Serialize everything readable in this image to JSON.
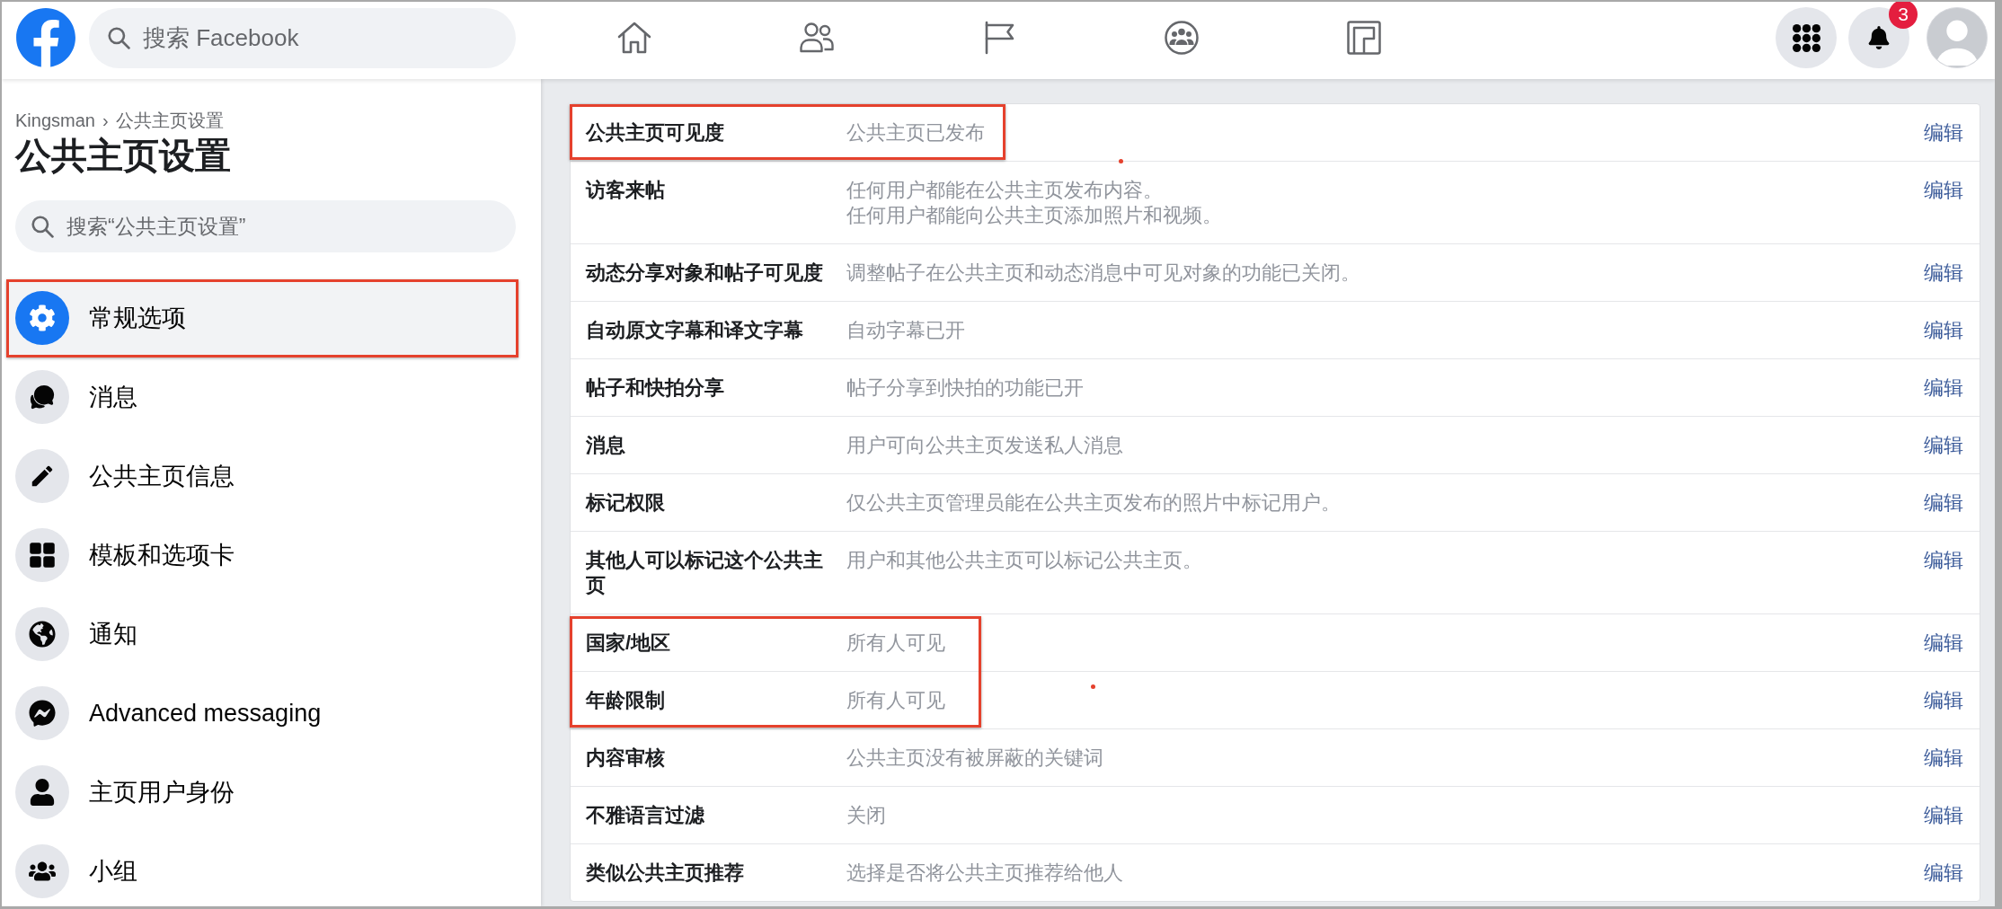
{
  "top_bar": {
    "search": {
      "placeholder": "搜索 Facebook"
    },
    "nav_tabs": [
      {
        "selected": false
      },
      {
        "selected": false
      },
      {
        "selected": false
      },
      {
        "selected": false
      },
      {
        "selected": false
      }
    ],
    "notification_badge": "3"
  },
  "sidebar": {
    "breadcrumb": {
      "items": [
        "Kingsman",
        "公共主页设置"
      ],
      "separator": "›"
    },
    "title": "公共主页设置",
    "search": {
      "placeholder": "搜索“公共主页设置”"
    },
    "items": [
      {
        "label": "常规选项",
        "selected": true,
        "annotated": true
      },
      {
        "label": "消息",
        "selected": false,
        "annotated": false
      },
      {
        "label": "公共主页信息",
        "selected": false,
        "annotated": false
      },
      {
        "label": "模板和选项卡",
        "selected": false,
        "annotated": false
      },
      {
        "label": "通知",
        "selected": false,
        "annotated": false
      },
      {
        "label": "Advanced messaging",
        "selected": false,
        "annotated": false
      },
      {
        "label": "主页用户身份",
        "selected": false,
        "annotated": false
      },
      {
        "label": "小组",
        "selected": false,
        "annotated": false
      }
    ]
  },
  "settings": {
    "rows": [
      {
        "label": "公共主页可见度",
        "value": [
          "公共主页已发布"
        ],
        "action": "编辑",
        "annotated": true
      },
      {
        "label": "访客来帖",
        "value": [
          "任何用户都能在公共主页发布内容。",
          "任何用户都能向公共主页添加照片和视频。"
        ],
        "action": "编辑",
        "annotated": false
      },
      {
        "label": "动态分享对象和帖子可见度",
        "value": [
          "调整帖子在公共主页和动态消息中可见对象的功能已关闭。"
        ],
        "action": "编辑",
        "annotated": false
      },
      {
        "label": "自动原文字幕和译文字幕",
        "value": [
          "自动字幕已开"
        ],
        "action": "编辑",
        "annotated": false
      },
      {
        "label": "帖子和快拍分享",
        "value": [
          "帖子分享到快拍的功能已开"
        ],
        "action": "编辑",
        "annotated": false
      },
      {
        "label": "消息",
        "value": [
          "用户可向公共主页发送私人消息"
        ],
        "action": "编辑",
        "annotated": false
      },
      {
        "label": "标记权限",
        "value": [
          "仅公共主页管理员能在公共主页发布的照片中标记用户。"
        ],
        "action": "编辑",
        "annotated": false
      },
      {
        "label": "其他人可以标记这个公共主页",
        "value": [
          "用户和其他公共主页可以标记公共主页。"
        ],
        "action": "编辑",
        "annotated": false
      },
      {
        "label": "国家/地区",
        "value": [
          "所有人可见"
        ],
        "action": "编辑",
        "annotated": true
      },
      {
        "label": "年龄限制",
        "value": [
          "所有人可见"
        ],
        "action": "编辑",
        "annotated": true
      },
      {
        "label": "内容审核",
        "value": [
          "公共主页没有被屏蔽的关键词"
        ],
        "action": "编辑",
        "annotated": false
      },
      {
        "label": "不雅语言过滤",
        "value": [
          "关闭"
        ],
        "action": "编辑",
        "annotated": false
      },
      {
        "label": "类似公共主页推荐",
        "value": [
          "选择是否将公共主页推荐给他人"
        ],
        "action": "编辑",
        "annotated": false
      }
    ]
  }
}
